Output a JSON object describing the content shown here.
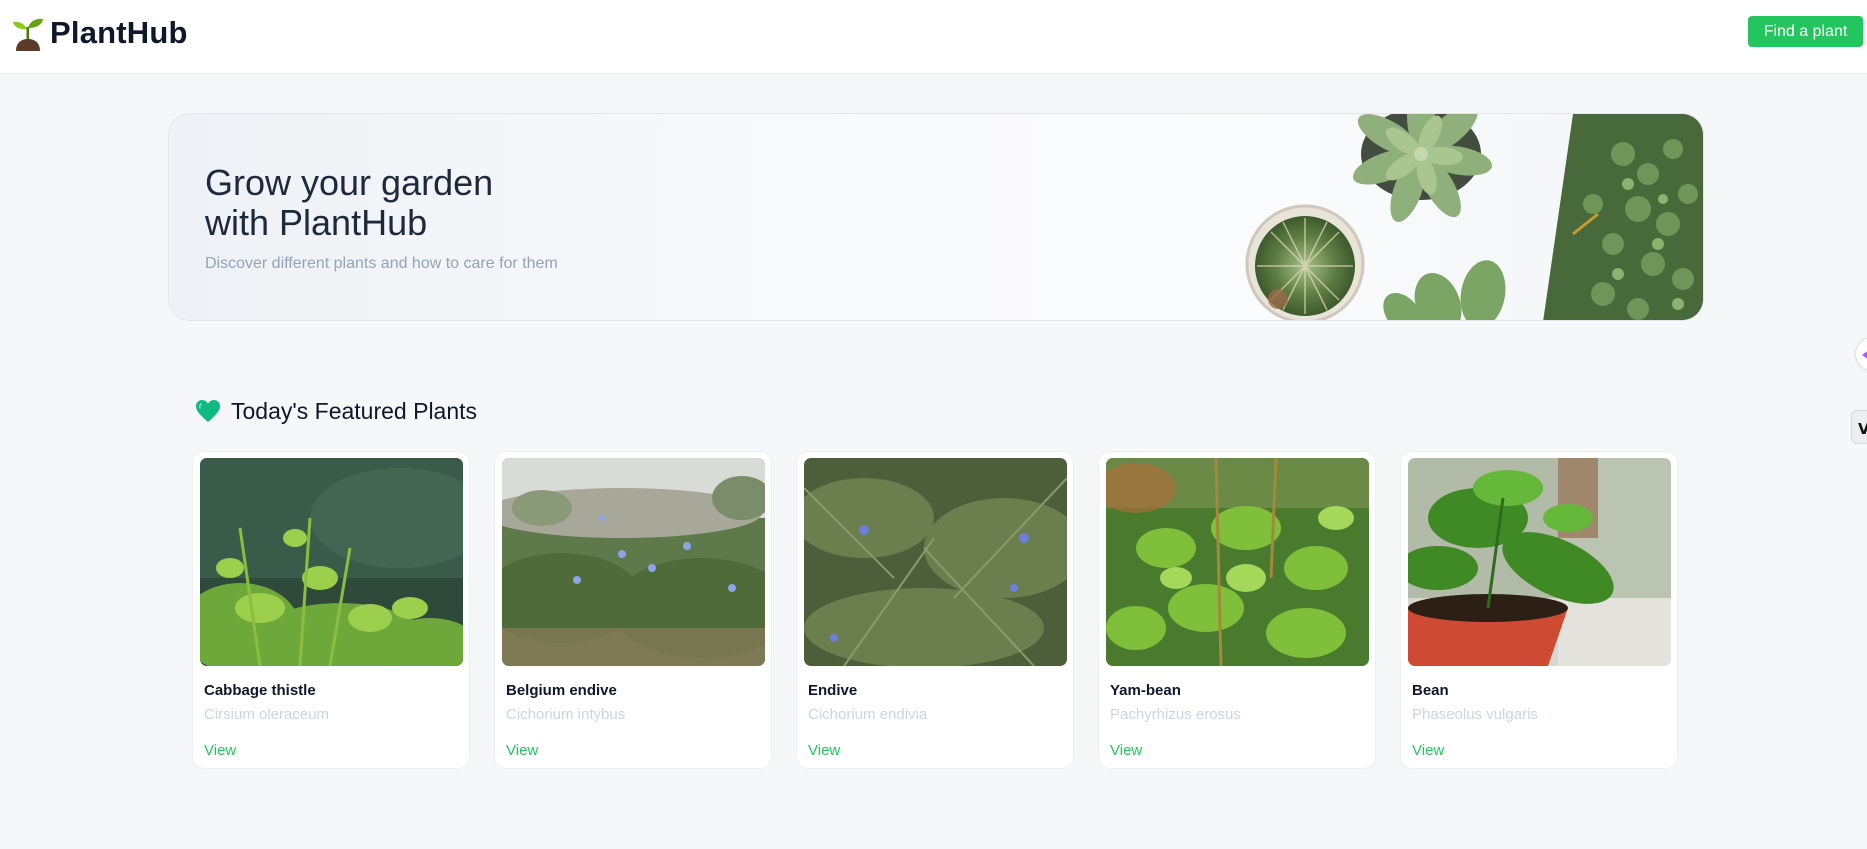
{
  "header": {
    "brand": "PlantHub",
    "brand_icon": "seedling-icon",
    "cta_label": "Find a plant",
    "accent": "#22c55e"
  },
  "hero": {
    "title_line1": "Grow your garden",
    "title_line2": "with PlantHub",
    "subtitle": "Discover different plants and how to care for them"
  },
  "featured": {
    "icon": "heart-icon",
    "title": "Today's Featured Plants",
    "items": [
      {
        "name": "Cabbage thistle",
        "scientific": "Cirsium oleraceum",
        "link": "View"
      },
      {
        "name": "Belgium endive",
        "scientific": "Cichorium intybus",
        "link": "View"
      },
      {
        "name": "Endive",
        "scientific": "Cichorium endivia",
        "link": "View"
      },
      {
        "name": "Yam-bean",
        "scientific": "Pachyrhizus erosus",
        "link": "View"
      },
      {
        "name": "Bean",
        "scientific": "Phaseolus vulgaris",
        "link": "View"
      }
    ]
  }
}
